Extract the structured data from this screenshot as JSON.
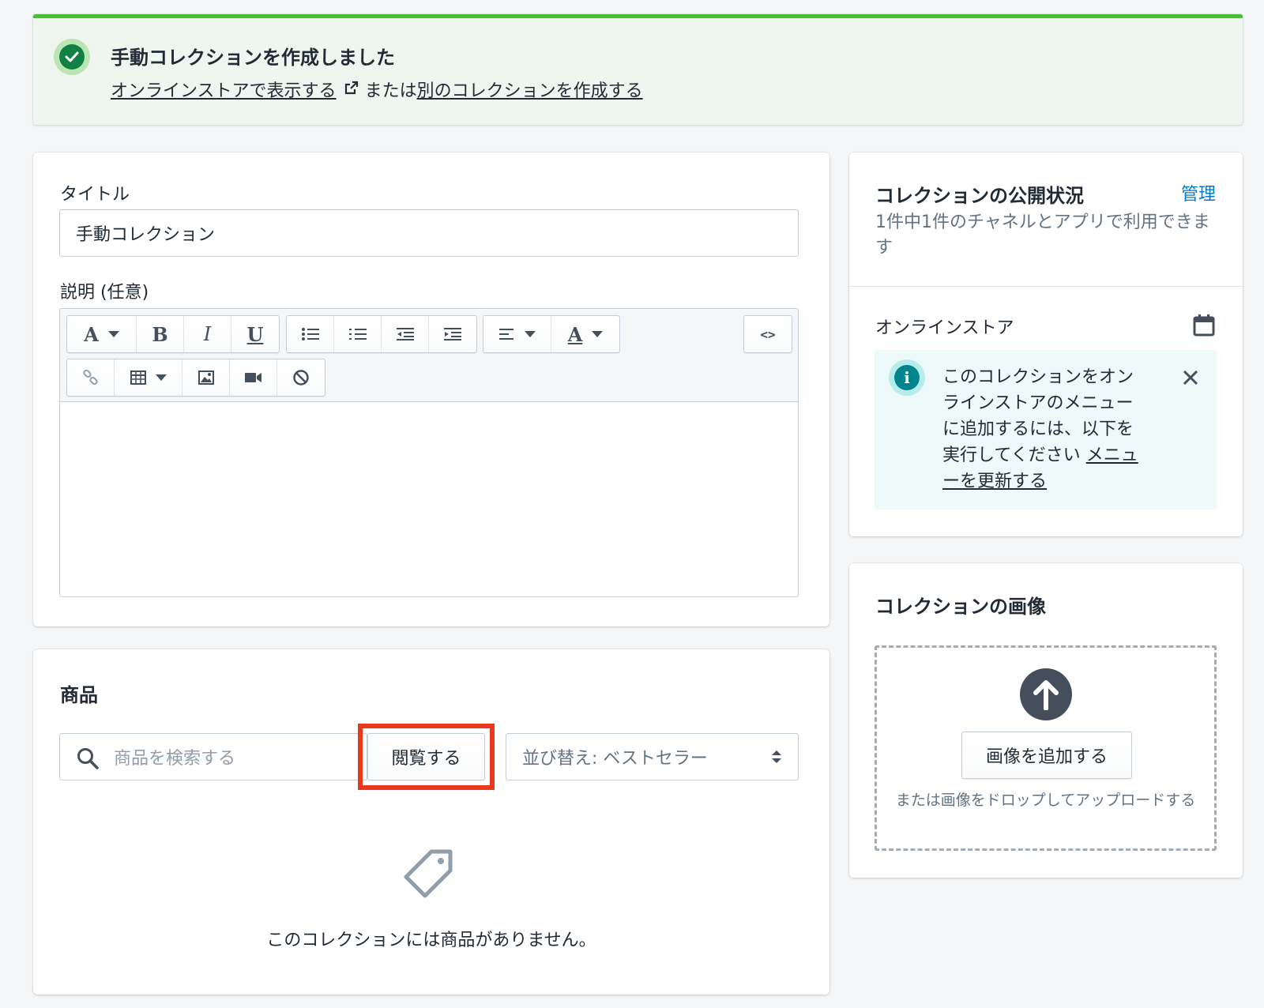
{
  "banner": {
    "title": "手動コレクションを作成しました",
    "view_link": "オンラインストアで表示する",
    "or_text": "または",
    "create_link": "別のコレクションを作成する",
    "status_color": "#50b83c"
  },
  "form": {
    "title_label": "タイトル",
    "title_value": "手動コレクション",
    "description_label": "説明 (任意)",
    "toolbar": {
      "font": "A",
      "bold": "B",
      "italic": "I",
      "underline": "U",
      "text_color": "A",
      "code": "<>"
    }
  },
  "products": {
    "title": "商品",
    "search_placeholder": "商品を検索する",
    "browse_label": "閲覧する",
    "sort_label": "並び替え: ベストセラー",
    "empty_text": "このコレクションには商品がありません。"
  },
  "availability": {
    "title": "コレクションの公開状況",
    "manage_label": "管理",
    "subtitle": "1件中1件のチャネルとアプリで利用できます",
    "channel": "オンラインストア",
    "info_text": "このコレクションをオンラインストアのメニューに追加するには、以下を実行してください",
    "info_link": "メニューを更新する",
    "accent_color": "#47c1bf"
  },
  "image": {
    "title": "コレクションの画像",
    "add_button": "画像を追加する",
    "drop_text": "または画像をドロップしてアップロードする"
  },
  "highlight_color": "#e8391f"
}
